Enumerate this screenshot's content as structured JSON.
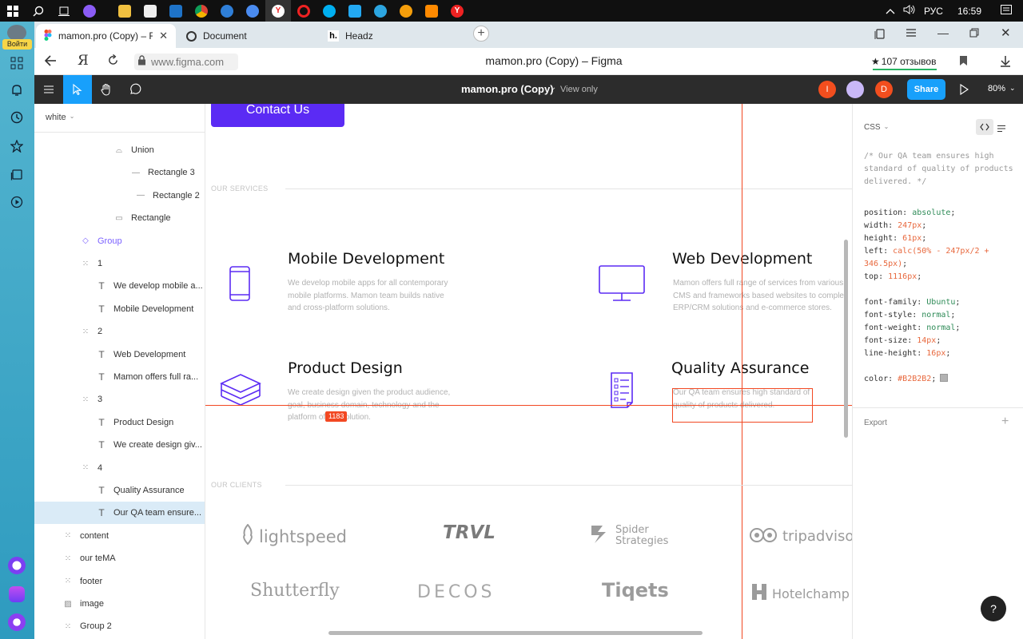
{
  "taskbar": {
    "tray": {
      "lang": "РУС",
      "time": "16:59"
    }
  },
  "yandex_panel": {
    "login_label": "Войти"
  },
  "browser": {
    "tabs": [
      {
        "title": "mamon.pro (Copy) – Fig"
      },
      {
        "title": "Document"
      },
      {
        "title": "Headz"
      }
    ],
    "address": "www.figma.com",
    "page_title": "mamon.pro (Copy) – Figma",
    "reviews": "107 отзывов"
  },
  "figma": {
    "file_name": "mamon.pro (Copy)",
    "view_mode": "View only",
    "share_label": "Share",
    "zoom": "80%",
    "avatars": [
      "I",
      "D"
    ],
    "page_name": "white"
  },
  "layers": [
    {
      "label": "Union",
      "icon": "union-icon"
    },
    {
      "label": "Rectangle 3",
      "icon": "line-icon"
    },
    {
      "label": "Rectangle 2",
      "icon": "line-icon"
    },
    {
      "label": "Rectangle",
      "icon": "rectangle-icon"
    },
    {
      "label": "Group",
      "icon": "component-icon"
    },
    {
      "label": "1",
      "icon": "frame-icon"
    },
    {
      "label": "We develop mobile a...",
      "icon": "text-icon"
    },
    {
      "label": "Mobile Development",
      "icon": "text-icon"
    },
    {
      "label": "2",
      "icon": "frame-icon"
    },
    {
      "label": "Web Development",
      "icon": "text-icon"
    },
    {
      "label": "Mamon offers full ra...",
      "icon": "text-icon"
    },
    {
      "label": "3",
      "icon": "frame-icon"
    },
    {
      "label": "Product Design",
      "icon": "text-icon"
    },
    {
      "label": "We create design giv...",
      "icon": "text-icon"
    },
    {
      "label": "4",
      "icon": "frame-icon"
    },
    {
      "label": "Quality Assurance",
      "icon": "text-icon"
    },
    {
      "label": "Our QA team ensure...",
      "icon": "text-icon"
    },
    {
      "label": "content",
      "icon": "frame-icon"
    },
    {
      "label": "our teMA",
      "icon": "frame-icon"
    },
    {
      "label": "footer",
      "icon": "frame-icon"
    },
    {
      "label": "image",
      "icon": "image-icon"
    },
    {
      "label": "Group 2",
      "icon": "frame-icon"
    }
  ],
  "canvas": {
    "contact_button": "Contact Us",
    "services_heading": "OUR SERVICES",
    "clients_heading": "OUR CLIENTS",
    "measure_badge": "1183",
    "services": [
      {
        "title": "Mobile Development",
        "text": "We develop mobile apps for all contemporary mobile platforms. Mamon team builds native and cross-platform solutions."
      },
      {
        "title": "Web Development",
        "text": "Mamon offers full range of services from various CMS and frameworks based websites to complex ERP/CRM solutions and e-commerce stores."
      },
      {
        "title": "Product Design",
        "text": "We create design given the product audience, goal, business domain, technology and the platform of the solution."
      },
      {
        "title": "Quality Assurance",
        "text": "Our QA team ensures high standard of quality of products delivered."
      }
    ],
    "clients": [
      "lightspeed",
      "TRVL",
      "Spider Strategies",
      "tripadvisor",
      "Shutterfly",
      "DECOS",
      "Tiqets",
      "Hotelchamp"
    ]
  },
  "inspect": {
    "section": "CSS",
    "comment": "/* Our QA team ensures high standard of quality of products delivered. */",
    "props": [
      {
        "k": "position",
        "v": "absolute"
      },
      {
        "k": "width",
        "v": "247px"
      },
      {
        "k": "height",
        "v": "61px"
      },
      {
        "k": "left",
        "v": "calc(50% - 247px/2 + 346.5px)"
      },
      {
        "k": "top",
        "v": "1116px"
      },
      {
        "k": "font-family",
        "v": "Ubuntu"
      },
      {
        "k": "font-style",
        "v": "normal"
      },
      {
        "k": "font-weight",
        "v": "normal"
      },
      {
        "k": "font-size",
        "v": "14px"
      },
      {
        "k": "line-height",
        "v": "16px"
      },
      {
        "k": "color",
        "v": "#B2B2B2"
      }
    ],
    "export_label": "Export"
  },
  "colors": {
    "accent": "#5b2bf4",
    "figma_blue": "#18a0fb",
    "measure_red": "#f24822",
    "toolbar": "#2c2c2c"
  }
}
